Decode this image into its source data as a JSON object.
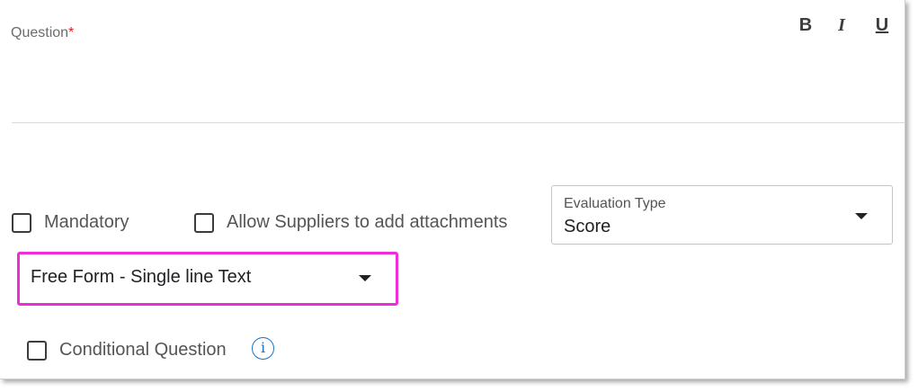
{
  "question": {
    "label": "Question",
    "required_marker": "*"
  },
  "toolbar": {
    "bold_label": "B",
    "italic_label": "I",
    "underline_label": "U"
  },
  "options": {
    "mandatory_label": "Mandatory",
    "mandatory_checked": false,
    "attachments_label": "Allow Suppliers to add attachments",
    "attachments_checked": false,
    "conditional_label": "Conditional Question",
    "conditional_checked": false
  },
  "evaluation": {
    "label": "Evaluation Type",
    "value": "Score"
  },
  "question_type": {
    "value": "Free Form - Single line Text"
  },
  "icons": {
    "dropdown": "caret-down-icon",
    "info": "info-icon",
    "info_glyph": "i"
  },
  "colors": {
    "highlight": "#ef2cd9",
    "required": "#e02020",
    "info": "#1a73c8"
  }
}
